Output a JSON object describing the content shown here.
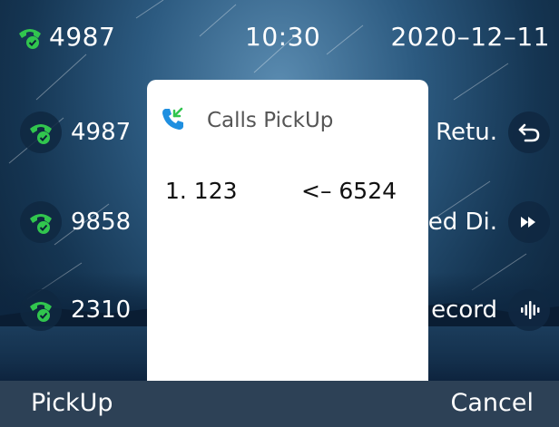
{
  "status": {
    "account": "4987",
    "time": "10:30",
    "date": "2020–12–11"
  },
  "lines": [
    {
      "label": "4987"
    },
    {
      "label": "9858"
    },
    {
      "label": "2310"
    }
  ],
  "functions": [
    {
      "label": "Retu."
    },
    {
      "label": "ed Di."
    },
    {
      "label": "ecord"
    }
  ],
  "dialog": {
    "title": "Calls PickUp",
    "entries": [
      {
        "index": "1. 123",
        "caller": "<– 6524"
      }
    ]
  },
  "softkeys": {
    "left": "PickUp",
    "right": "Cancel"
  },
  "colors": {
    "accent_green": "#31c54e",
    "dialog_icon_blue": "#1f8fe0",
    "softkey_bar": "#2d4156"
  },
  "icons": {
    "account": "phone-registered-icon",
    "line": "phone-registered-icon",
    "return": "return-arrow-icon",
    "forward": "fast-forward-icon",
    "record": "voice-record-icon",
    "pickup": "call-pickup-icon"
  }
}
